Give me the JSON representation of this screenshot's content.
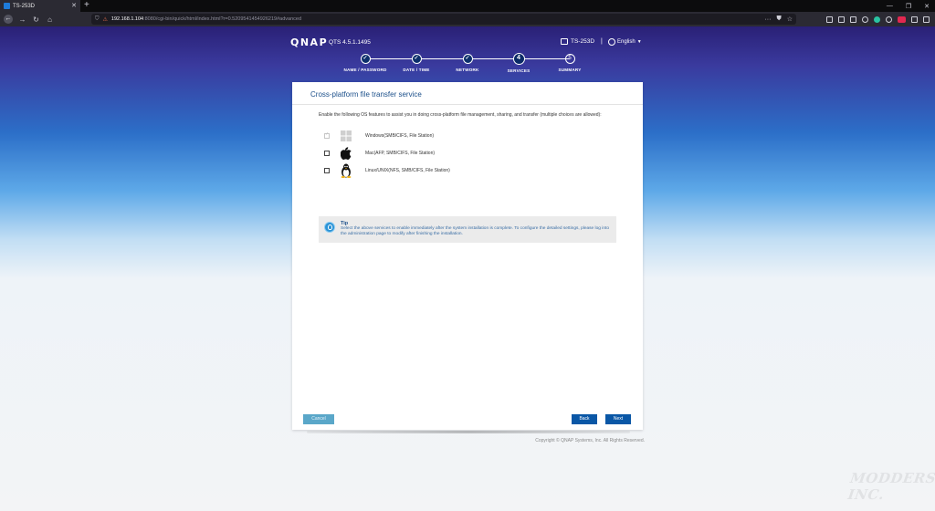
{
  "browser": {
    "tab_title": "TS-253D",
    "url_host": "192.168.1.104",
    "url_rest": ":8080/cgi-bin/quick/html/index.html?r=0.5209541454926219#advanced"
  },
  "header": {
    "logo": "QNAP",
    "qts_version": "QTS 4.5.1.1495",
    "model": "TS-253D",
    "separator": "|",
    "language": "English"
  },
  "steps": [
    {
      "label": "NAME / PASSWORD",
      "marker": "✓",
      "state": "done"
    },
    {
      "label": "DATE / TIME",
      "marker": "✓",
      "state": "done"
    },
    {
      "label": "NETWORK",
      "marker": "✓",
      "state": "done"
    },
    {
      "label": "SERVICES",
      "marker": "4",
      "state": "current"
    },
    {
      "label": "SUMMARY",
      "marker": "5",
      "state": "pending"
    }
  ],
  "panel": {
    "title": "Cross-platform file transfer service",
    "intro": "Enable the following OS features to assist you in doing cross-platform file management, sharing, and transfer (multiple choices are allowed):",
    "options": [
      {
        "label": "Windows(SMB/CIFS, File Station)",
        "icon": "windows-icon",
        "checked": true,
        "disabled": true
      },
      {
        "label": "Mac(AFP, SMB/CIFS, File Station)",
        "icon": "apple-icon",
        "checked": false,
        "disabled": false
      },
      {
        "label": "Linux/UNIX(NFS, SMB/CIFS, File Station)",
        "icon": "tux-icon",
        "checked": false,
        "disabled": false
      }
    ],
    "tip_title": "Tip",
    "tip_text": "Select the above services to enable immediately after the system installation is complete. To configure the detailed settings, please log into the administration page to modify after finishing the installation."
  },
  "buttons": {
    "cancel": "Cancel",
    "back": "Back",
    "next": "Next"
  },
  "footer": {
    "copyright": "Copyright © QNAP Systems, Inc. All Rights Reserved."
  },
  "colors": {
    "accent": "#0a57a6",
    "title": "#1b4f8a",
    "cancel": "#5aa7c9"
  }
}
